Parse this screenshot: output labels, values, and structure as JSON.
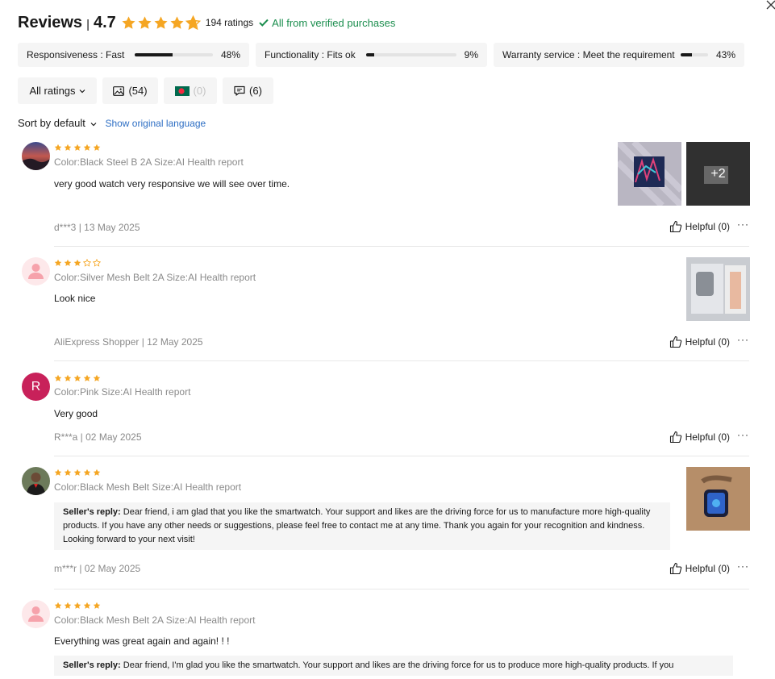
{
  "header": {
    "title": "Reviews",
    "separator": "|",
    "score": "4.7",
    "ratings_count": "194 ratings",
    "verified_text": "All from verified purchases",
    "star_fill": [
      1,
      1,
      1,
      1,
      0.7
    ]
  },
  "metrics": [
    {
      "label": "Responsiveness : Fast",
      "percent": "48%",
      "value": 0.48
    },
    {
      "label": "Functionality : Fits ok",
      "percent": "9%",
      "value": 0.09
    },
    {
      "label": "Warranty service : Meet the requirement",
      "percent": "43%",
      "value": 0.43
    }
  ],
  "filters": {
    "all_ratings": "All ratings",
    "photos_count": "(54)",
    "country_count": "(0)",
    "comments_count": "(6)"
  },
  "sort": {
    "label": "Sort by default",
    "show_original": "Show original language"
  },
  "reviews": [
    {
      "rating": 5,
      "attributes": "Color:Black Steel B 2A Size:AI Health report",
      "text": "very good watch very responsive we will see over time.",
      "meta": "d***3 | 13 May 2025",
      "helpful": "Helpful (0)",
      "more_photos": "+2"
    },
    {
      "rating": 3,
      "attributes": "Color:Silver Mesh Belt 2A Size:AI Health report",
      "text": "Look nice",
      "meta": "AliExpress Shopper | 12 May 2025",
      "helpful": "Helpful (0)"
    },
    {
      "rating": 5,
      "avatar_letter": "R",
      "attributes": "Color:Pink Size:AI Health report",
      "text": "Very good",
      "meta": "R***a | 02 May 2025",
      "helpful": "Helpful (0)"
    },
    {
      "rating": 5,
      "attributes": "Color:Black Mesh Belt Size:AI Health report",
      "reply_label": "Seller's reply:",
      "reply_text": " Dear friend, i am glad that you like the smartwatch. Your support and likes are the driving force for us to manufacture more high-quality products. If you have any other needs or suggestions, please feel free to contact me at any time. Thank you again for your recognition and kindness. Looking forward to your next visit!",
      "meta": "m***r | 02 May 2025",
      "helpful": "Helpful (0)"
    },
    {
      "rating": 5,
      "attributes": "Color:Black Mesh Belt 2A Size:AI Health report",
      "text": "Everything was great again and again! ! !",
      "reply_label": "Seller's reply:",
      "reply_text": " Dear friend, I'm glad you like the smartwatch. Your support and likes are the driving force for us to produce more high-quality products. If you"
    }
  ],
  "colors": {
    "star": "#f5a623",
    "verified": "#1b8e4e",
    "link": "#2e6fc4",
    "avatar_r": "#c8215a"
  },
  "more_menu": "···"
}
